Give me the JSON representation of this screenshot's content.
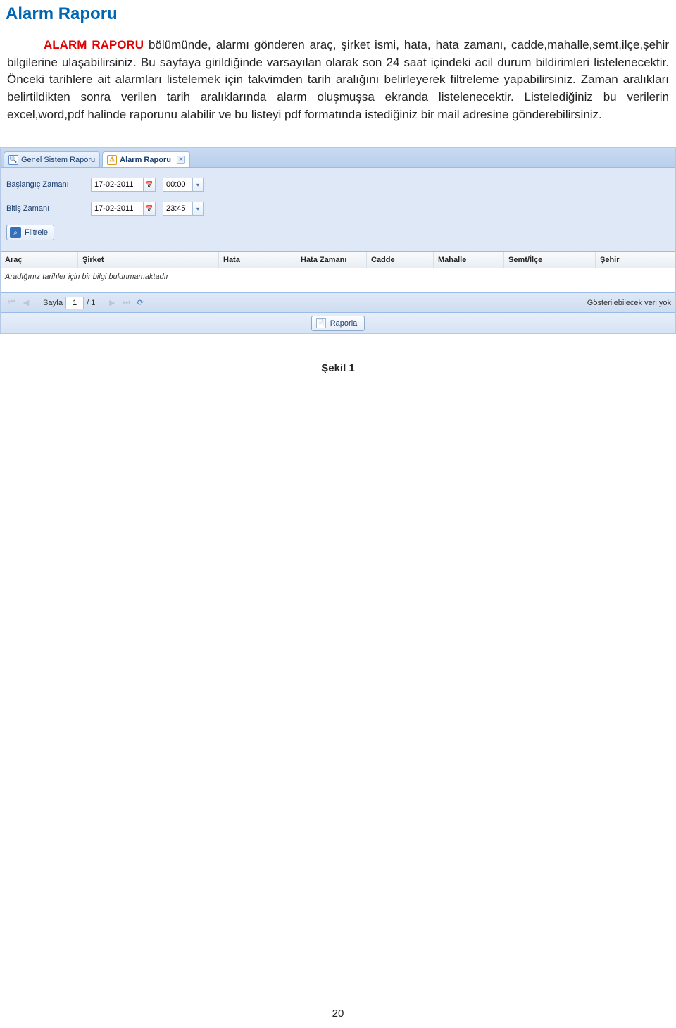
{
  "doc": {
    "title": "Alarm Raporu",
    "leadin": "ALARM RAPORU",
    "para_before": " bölümünde, alarmı gönderen araç, şirket ismi, hata, hata zamanı, cadde,mahalle,semt,ilçe,şehir bilgilerine ulaşabilirsiniz. Bu sayfaya girildiğinde varsayılan olarak son 24 saat içindeki acil durum bildirimleri listelenecektir. Önceki tarihlere ait alarmları listelemek için takvimden tarih aralığını belirleyerek filtreleme yapabilirsiniz. Zaman aralıkları belirtildikten sonra verilen tarih aralıklarında alarm oluşmuşsa ekranda listelenecektir. Listelediğiniz bu verilerin excel,word,pdf halinde raporunu alabilir ve bu listeyi pdf formatında istediğiniz bir mail adresine gönderebilirsiniz.",
    "figure_caption": "Şekil 1",
    "page_number": "20"
  },
  "tabs": {
    "general": "Genel Sistem Raporu",
    "alarm": "Alarm Raporu"
  },
  "filters": {
    "start_label": "Başlangıç Zamanı",
    "start_date": "17-02-2011",
    "start_time": "00:00",
    "end_label": "Bitiş Zamanı",
    "end_date": "17-02-2011",
    "end_time": "23:45",
    "filter_btn": "Filtrele"
  },
  "grid": {
    "headers": {
      "arac": "Araç",
      "sirket": "Şirket",
      "hata": "Hata",
      "hataz": "Hata Zamanı",
      "cadde": "Cadde",
      "mahalle": "Mahalle",
      "semt": "Semt/İlçe",
      "sehir": "Şehir"
    },
    "empty_text": "Aradığınız tarihler için bir bilgi bulunmamaktadır",
    "toolbar": {
      "page_label": "Sayfa",
      "page_current": "1",
      "page_total": "/ 1",
      "status": "Gösterilebilecek veri yok"
    }
  },
  "report": {
    "btn": "Raporla"
  }
}
